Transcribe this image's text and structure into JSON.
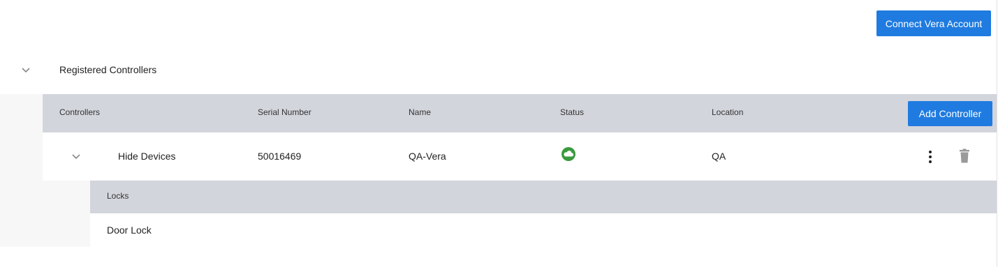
{
  "header": {
    "connect_button": "Connect Vera Account"
  },
  "section": {
    "title": "Registered Controllers"
  },
  "table": {
    "columns": [
      "Controllers",
      "Serial Number",
      "Name",
      "Status",
      "Location"
    ],
    "add_button": "Add Controller",
    "rows": [
      {
        "toggle_label": "Hide Devices",
        "serial": "50016469",
        "name": "QA-Vera",
        "status": "cloud-online-icon",
        "location": "QA",
        "sub_group": {
          "header": "Locks",
          "items": [
            "Door Lock"
          ]
        }
      }
    ]
  },
  "colors": {
    "accent": "#1f7be0",
    "status_online": "#3a9a3e",
    "header_bg": "#d3d5dc"
  }
}
